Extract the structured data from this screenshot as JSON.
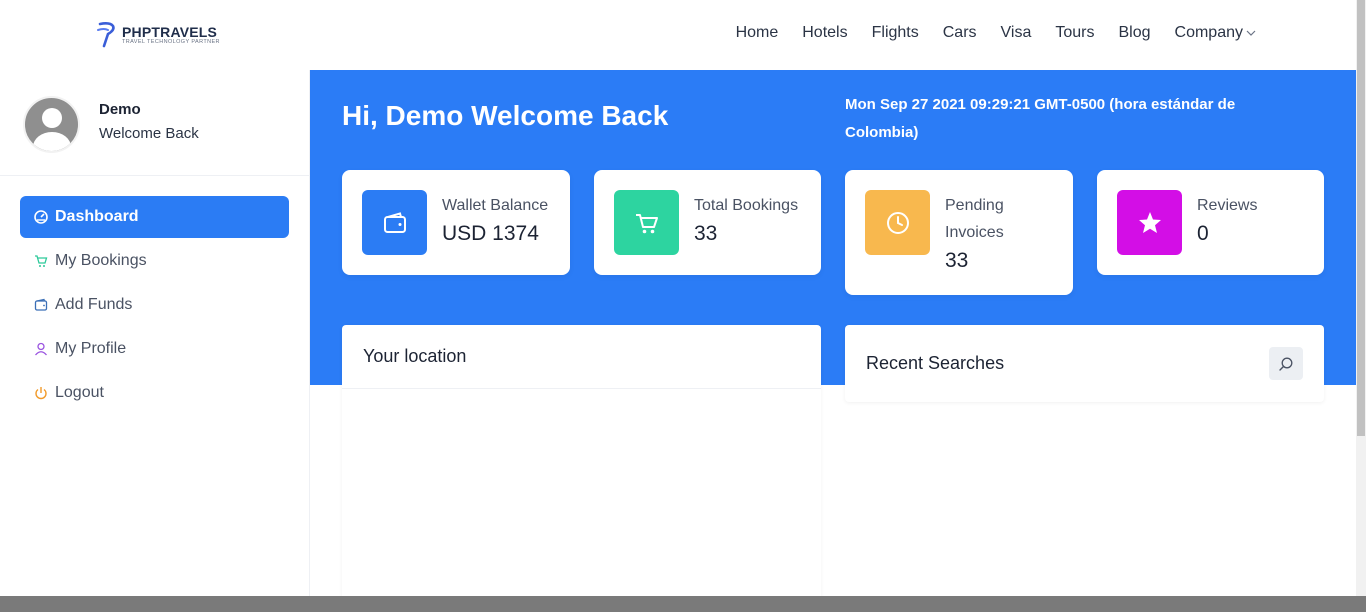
{
  "brand": {
    "name": "PHPTRAVELS",
    "tagline": "TRAVEL TECHNOLOGY PARTNER"
  },
  "nav": {
    "items": [
      "Home",
      "Hotels",
      "Flights",
      "Cars",
      "Visa",
      "Tours",
      "Blog",
      "Company"
    ]
  },
  "user": {
    "name": "Demo",
    "subtitle": "Welcome Back"
  },
  "sidebar": {
    "items": [
      {
        "label": "Dashboard",
        "icon": "dashboard-icon",
        "active": true
      },
      {
        "label": "My Bookings",
        "icon": "cart-icon"
      },
      {
        "label": "Add Funds",
        "icon": "wallet-icon"
      },
      {
        "label": "My Profile",
        "icon": "user-icon"
      },
      {
        "label": "Logout",
        "icon": "power-icon"
      }
    ]
  },
  "main": {
    "greeting": "Hi, Demo Welcome Back",
    "datetime": "Mon Sep 27 2021 09:29:21 GMT-0500 (hora estándar de Colombia)",
    "stats": [
      {
        "label": "Wallet Balance",
        "value": "USD 1374",
        "icon": "wallet-icon",
        "color": "#2b7cf4"
      },
      {
        "label": "Total Bookings",
        "value": "33",
        "icon": "cart-icon",
        "color": "#2dd4a0"
      },
      {
        "label": "Pending Invoices",
        "value": "33",
        "icon": "clock-icon",
        "color": "#f8b84e"
      },
      {
        "label": "Reviews",
        "value": "0",
        "icon": "star-icon",
        "color": "#d30ee6"
      }
    ],
    "location_title": "Your location",
    "recent_title": "Recent Searches"
  },
  "colors": {
    "primary": "#2b7cf6",
    "text": "#1c2333"
  }
}
